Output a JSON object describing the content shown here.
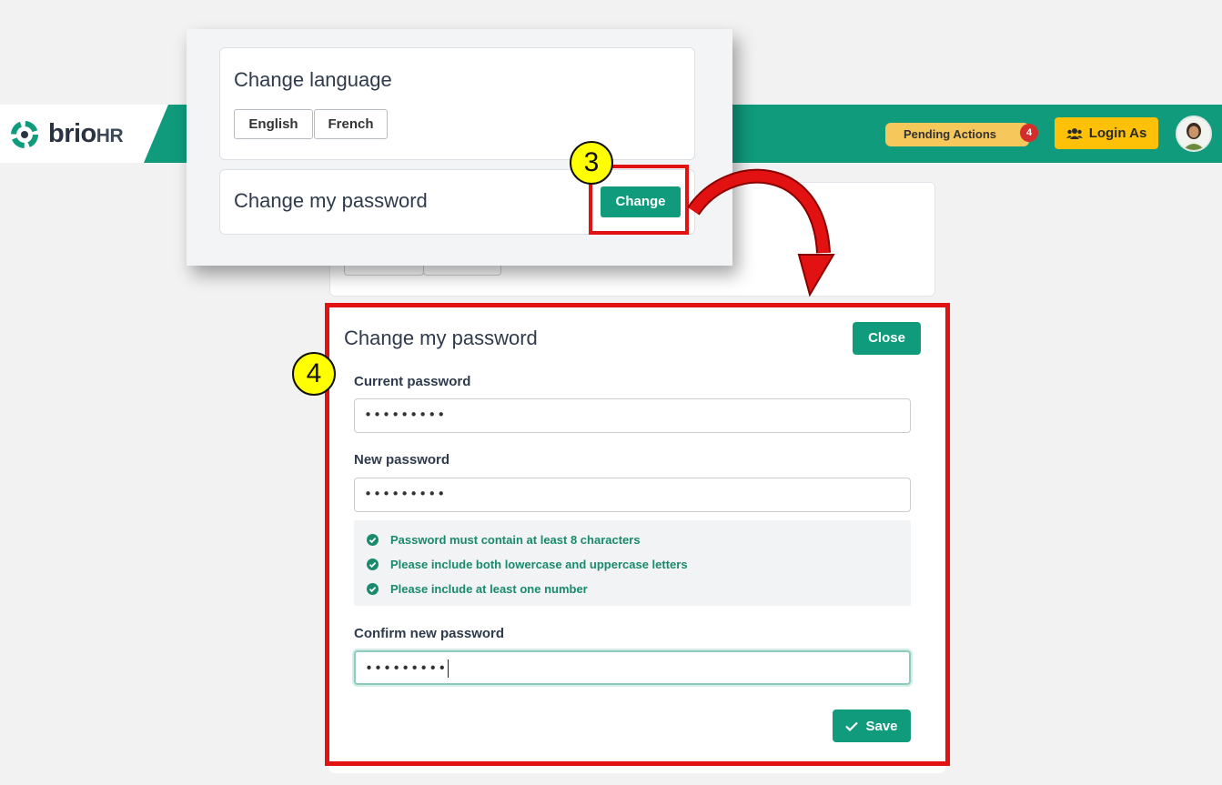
{
  "header": {
    "logo_text": "brio",
    "logo_suffix": "HR",
    "pending_actions_label": "Pending Actions",
    "pending_actions_count": "4",
    "login_as_label": "Login As",
    "colors": {
      "brand": "#0f9b7c",
      "pending": "#f6c75a",
      "login_as": "#ffc107",
      "badge": "#d32d2d"
    }
  },
  "settings": {
    "language_title": "Change language",
    "language_options": [
      "English",
      "French"
    ],
    "password_title": "Change my password",
    "change_button": "Change"
  },
  "steps": {
    "first": "3",
    "second": "4"
  },
  "password_form": {
    "title": "Change my password",
    "close_button": "Close",
    "current_label": "Current password",
    "current_value": "•••••••••",
    "new_label": "New password",
    "new_value": "•••••••••",
    "rules": [
      "Password must contain at least 8 characters",
      "Please include both lowercase and uppercase letters",
      "Please include at least one number"
    ],
    "confirm_label": "Confirm new password",
    "confirm_value": "•••••••••",
    "save_button": "Save"
  },
  "callout_color": "#e31212"
}
